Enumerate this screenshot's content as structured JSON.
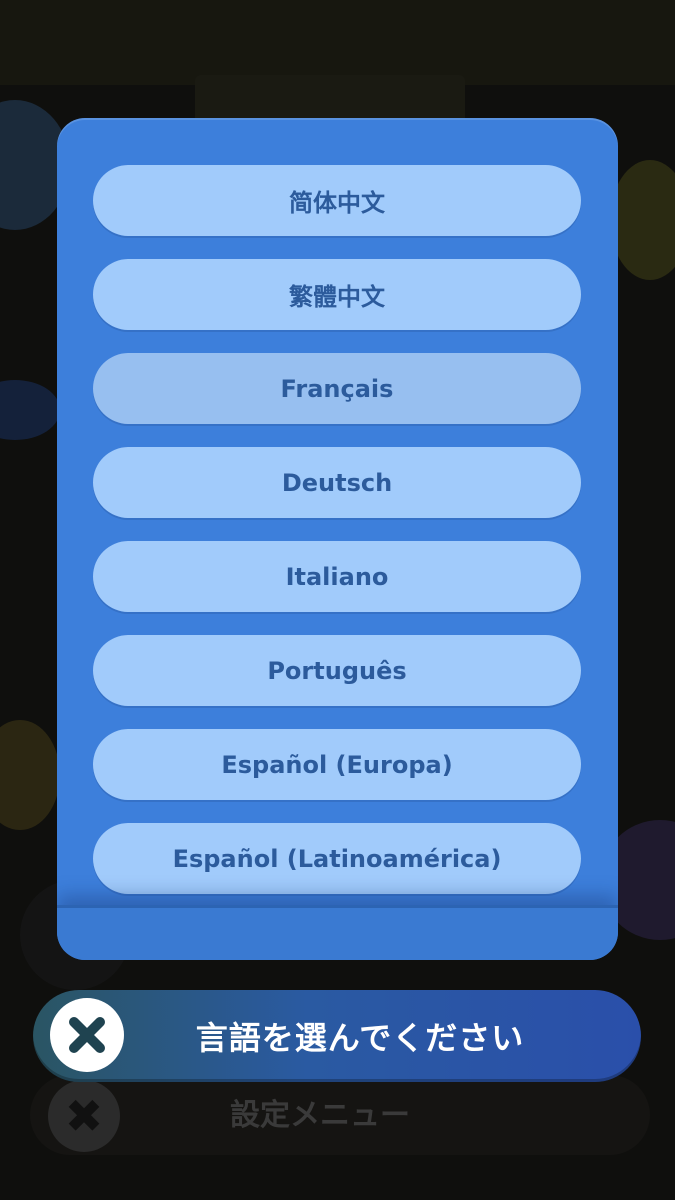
{
  "dialog": {
    "languages": [
      {
        "label": "简体中文",
        "selected": false
      },
      {
        "label": "繁體中文",
        "selected": false
      },
      {
        "label": "Français",
        "selected": true
      },
      {
        "label": "Deutsch",
        "selected": false
      },
      {
        "label": "Italiano",
        "selected": false
      },
      {
        "label": "Português",
        "selected": false
      },
      {
        "label": "Español (Europa)",
        "selected": false
      },
      {
        "label": "Español (Latinoamérica)",
        "selected": false
      }
    ]
  },
  "header": {
    "title": "言語を選んでください",
    "close_icon": "close-x-icon"
  },
  "background": {
    "menu_label": "設定メニュー",
    "menu_icon": "close-x-icon"
  },
  "colors": {
    "panel": "#3d7fdb",
    "button": "#a1cbfb",
    "button_selected": "#97bff0",
    "button_text": "#2c5b9c"
  }
}
